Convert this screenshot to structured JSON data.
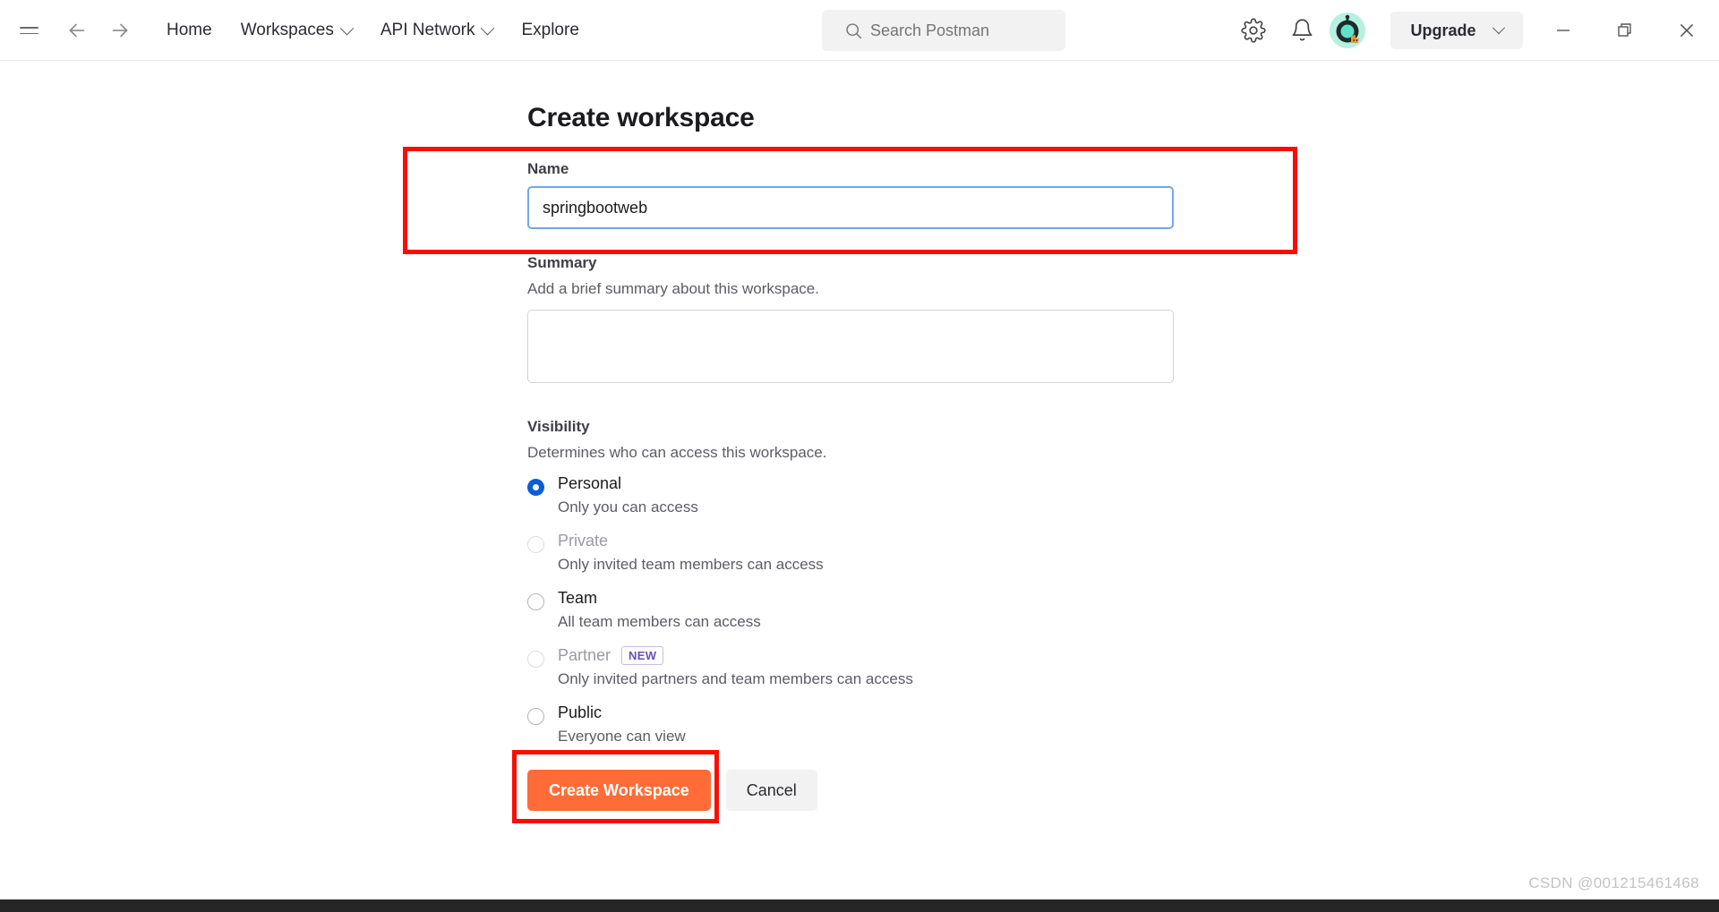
{
  "header": {
    "menu_icon": "hamburger-icon",
    "back_icon": "arrow-left-icon",
    "forward_icon": "arrow-right-icon",
    "nav_items": [
      {
        "label": "Home",
        "has_chevron": false
      },
      {
        "label": "Workspaces",
        "has_chevron": true
      },
      {
        "label": "API Network",
        "has_chevron": true
      },
      {
        "label": "Explore",
        "has_chevron": false
      }
    ],
    "search": {
      "icon": "search-icon",
      "placeholder": "Search Postman",
      "value": ""
    },
    "settings_icon": "gear-icon",
    "notifications_icon": "bell-icon",
    "avatar": "user-avatar",
    "upgrade": {
      "label": "Upgrade",
      "chevron": "chevron-down-icon"
    },
    "window_controls": {
      "minimize": "minimize-icon",
      "maximize": "restore-icon",
      "close": "close-icon"
    }
  },
  "main": {
    "title": "Create workspace",
    "name_field": {
      "label": "Name",
      "value": "springbootweb",
      "placeholder": ""
    },
    "summary_field": {
      "label": "Summary",
      "hint": "Add a brief summary about this workspace.",
      "value": "",
      "placeholder": ""
    },
    "visibility": {
      "label": "Visibility",
      "hint": "Determines who can access this workspace.",
      "options": [
        {
          "title": "Personal",
          "subtitle": "Only you can access",
          "selected": true,
          "disabled": false,
          "badge": ""
        },
        {
          "title": "Private",
          "subtitle": "Only invited team members can access",
          "selected": false,
          "disabled": true,
          "badge": ""
        },
        {
          "title": "Team",
          "subtitle": "All team members can access",
          "selected": false,
          "disabled": false,
          "badge": ""
        },
        {
          "title": "Partner",
          "subtitle": "Only invited partners and team members can access",
          "selected": false,
          "disabled": true,
          "badge": "NEW"
        },
        {
          "title": "Public",
          "subtitle": "Everyone can view",
          "selected": false,
          "disabled": false,
          "badge": ""
        }
      ]
    },
    "actions": {
      "primary_label": "Create Workspace",
      "secondary_label": "Cancel"
    }
  },
  "annotations": {
    "color": "#fb0d05",
    "boxes": [
      "name-field-highlight",
      "create-workspace-button-highlight"
    ]
  },
  "footer": {
    "watermark": "CSDN @001215461468"
  },
  "colors": {
    "accent_orange": "#ff6c37",
    "radio_blue": "#0b5cd5",
    "focus_blue": "#6fa8e8",
    "badge_purple": "#6b4fbb",
    "annotation_red": "#fb0d05"
  }
}
